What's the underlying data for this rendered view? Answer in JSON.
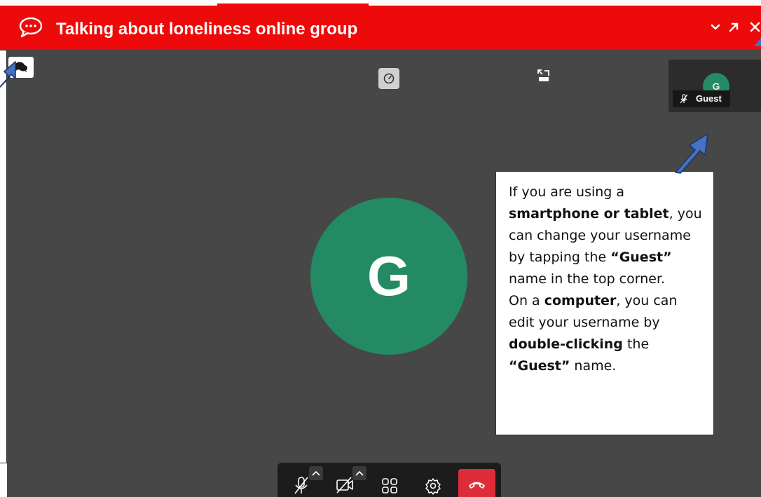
{
  "window": {
    "title": "Talking about loneliness online group",
    "icons": {
      "chat": "speech-bubble-icon",
      "collapse": "chevron-down-icon",
      "popout": "arrow-up-right-icon",
      "close": "close-icon"
    }
  },
  "colors": {
    "header": "#ee0a0a",
    "stage": "#474747",
    "avatar": "#238a64",
    "hangup": "#dd2d3b"
  },
  "participant": {
    "initial": "G",
    "name": "Guest"
  },
  "callout": {
    "line1_a": "If you are using a ",
    "line1_b": "smartphone or tablet",
    "line1_c": ", you can change your username by tapping the ",
    "line1_d": "“Guest”",
    "line1_e": " name in the top corner.",
    "line2_a": "On a ",
    "line2_b": "computer",
    "line2_c": ", you can edit your username by ",
    "line2_d": "double-clicking",
    "line2_e": " the ",
    "line2_f": "“Guest”",
    "line2_g": " name."
  },
  "toolbar": {
    "items": [
      "microphone-muted-icon",
      "camera-off-icon",
      "tile-view-icon",
      "settings-icon",
      "hang-up-icon"
    ]
  }
}
